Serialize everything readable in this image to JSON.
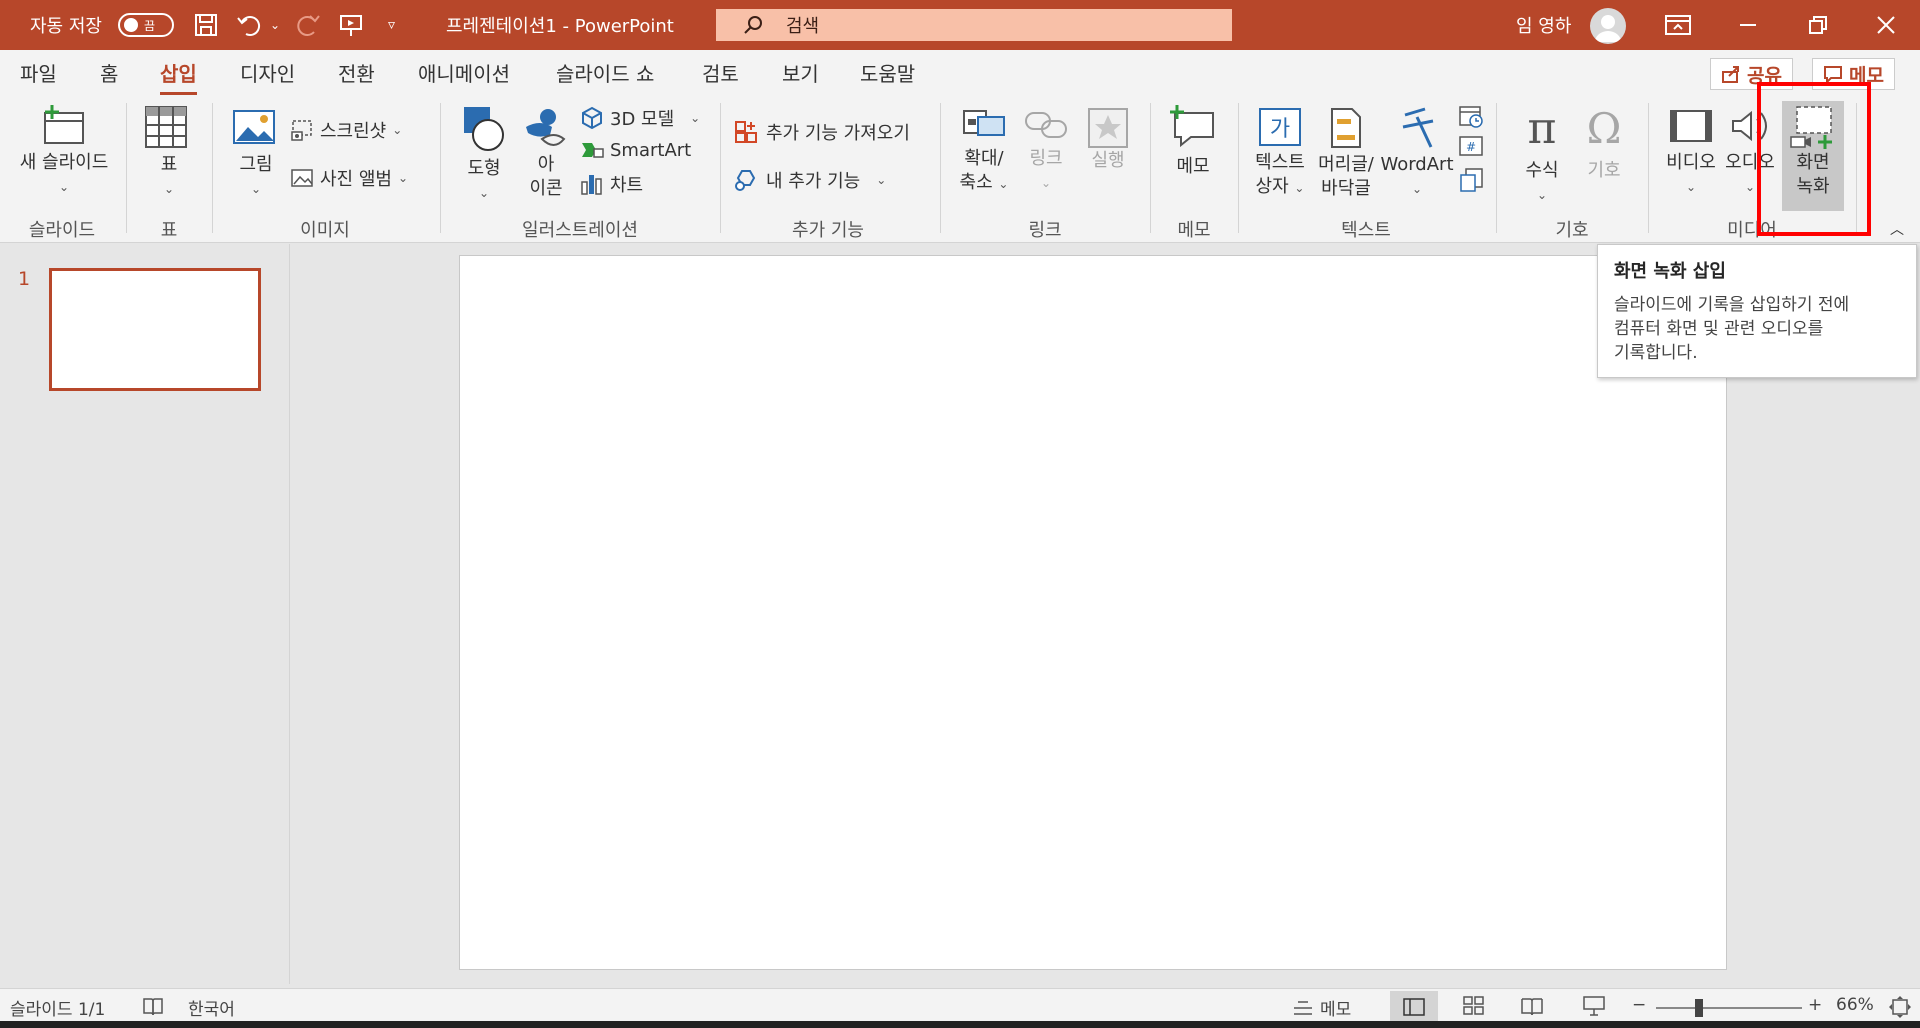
{
  "titlebar": {
    "autosave_label": "자동 저장",
    "autosave_state": "끔",
    "doc_title": "프레젠테이션1  -  PowerPoint",
    "search_placeholder": "검색",
    "user_name": "임 영하"
  },
  "tabs": [
    "파일",
    "홈",
    "삽입",
    "디자인",
    "전환",
    "애니메이션",
    "슬라이드 쇼",
    "검토",
    "보기",
    "도움말"
  ],
  "active_tab": "삽입",
  "share_label": "공유",
  "memo_label": "메모",
  "ribbon": {
    "new_slide": "새 슬라이드",
    "table": "표",
    "picture": "그림",
    "screenshot": "스크린샷",
    "photo_album": "사진 앨범",
    "shapes": "도형",
    "icons_line1": "아",
    "icons_line2": "이콘",
    "model3d": "3D 모델",
    "smartart": "SmartArt",
    "chart": "차트",
    "get_addins": "추가 기능 가져오기",
    "my_addins": "내 추가 기능",
    "zoom_line1": "확대/",
    "zoom_line2": "축소",
    "link": "링크",
    "action": "실행",
    "comment": "메모",
    "textbox_line1": "텍스트",
    "textbox_line2": "상자",
    "header_line1": "머리글/",
    "header_line2": "바닥글",
    "wordart": "WordArt",
    "equation": "수식",
    "symbol": "기호",
    "video": "비디오",
    "audio": "오디오",
    "screen_rec_line1": "화면",
    "screen_rec_line2": "녹화",
    "groups": {
      "slides": "슬라이드",
      "tables": "표",
      "images": "이미지",
      "illustrations": "일러스트레이션",
      "addins": "추가 기능",
      "links": "링크",
      "comments": "메모",
      "text": "텍스트",
      "symbols": "기호",
      "media": "미디어"
    }
  },
  "thumbnails": {
    "slide_number": "1"
  },
  "tooltip": {
    "title": "화면 녹화 삽입",
    "body_line1": "슬라이드에 기록을 삽입하기 전에",
    "body_line2": "컴퓨터 화면 및 관련 오디오를",
    "body_line3": "기록합니다."
  },
  "status": {
    "slide_counter": "슬라이드 1/1",
    "language": "한국어",
    "notes": "메모",
    "zoom_percent": "66%"
  },
  "colors": {
    "accent": "#b7472a",
    "highlight": "#ff0000"
  }
}
